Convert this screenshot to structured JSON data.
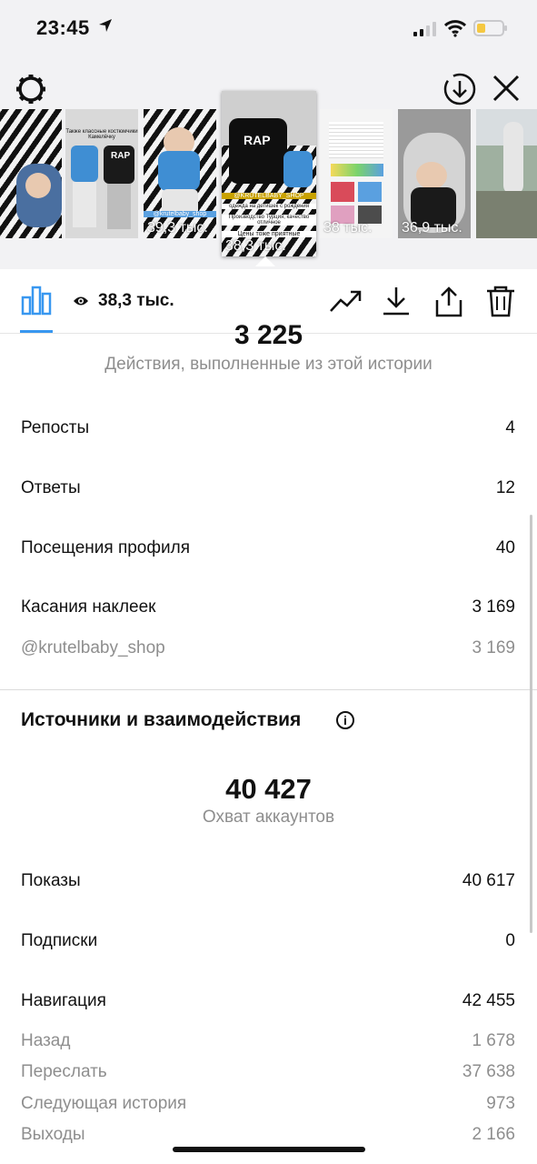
{
  "status_bar": {
    "time": "23:45"
  },
  "stories": [
    {
      "views": ""
    },
    {
      "views": "",
      "caption": "Также классные костюмчики Камелёчку"
    },
    {
      "views": "39,3 тыс.",
      "tag": "@krutelbaby_shop"
    },
    {
      "views": "38,3 тыс.",
      "tag": "@KRUTELBABY_SHOP",
      "caption1": "одежда на детишек с рождения",
      "caption2": "Производство Турция, качество отличное",
      "caption3": "Цены тоже приятные"
    },
    {
      "views": "38 тыс."
    },
    {
      "views": "36,9 тыс."
    },
    {
      "views": ""
    }
  ],
  "toolbar": {
    "views_count": "38,3 тыс."
  },
  "stats": {
    "top_number": "3 225",
    "actions_label": "Действия, выполненные из этой истории",
    "rows": [
      {
        "label": "Репосты",
        "value": "4"
      },
      {
        "label": "Ответы",
        "value": "12"
      },
      {
        "label": "Посещения профиля",
        "value": "40"
      },
      {
        "label": "Касания наклеек",
        "value": "3 169"
      },
      {
        "label": "@krutelbaby_shop",
        "value": "3 169"
      }
    ]
  },
  "sources": {
    "title": "Источники и взаимодействия",
    "reach_value": "40 427",
    "reach_label": "Охват аккаунтов",
    "rows": [
      {
        "label": "Показы",
        "value": "40 617"
      },
      {
        "label": "Подписки",
        "value": "0"
      },
      {
        "label": "Навигация",
        "value": "42 455"
      },
      {
        "label": "Назад",
        "value": "1 678"
      },
      {
        "label": "Переслать",
        "value": "37 638"
      },
      {
        "label": "Следующая история",
        "value": "973"
      },
      {
        "label": "Выходы",
        "value": "2 166"
      }
    ]
  },
  "colors": {
    "accent": "#3897f0",
    "battery": "#f5c842",
    "secondary_text": "#8e8e8e"
  }
}
